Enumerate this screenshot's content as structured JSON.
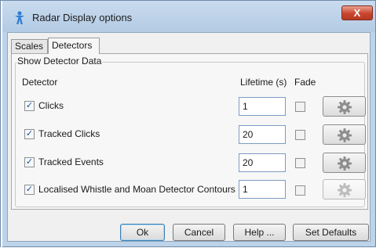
{
  "window": {
    "title": "Radar Display options",
    "close_label": "X"
  },
  "tabs": [
    {
      "label": "Scales",
      "selected": false
    },
    {
      "label": "Detectors",
      "selected": true
    }
  ],
  "group": {
    "title": "Show Detector Data",
    "col_detector": "Detector",
    "col_lifetime": "Lifetime (s)",
    "col_fade": "Fade"
  },
  "rows": [
    {
      "label": "Clicks",
      "checked": true,
      "lifetime": "1",
      "fade": false,
      "settings_enabled": true
    },
    {
      "label": "Tracked Clicks",
      "checked": true,
      "lifetime": "20",
      "fade": false,
      "settings_enabled": true
    },
    {
      "label": "Tracked Events",
      "checked": true,
      "lifetime": "20",
      "fade": false,
      "settings_enabled": true
    },
    {
      "label": "Localised Whistle and Moan Detector Contours",
      "checked": true,
      "lifetime": "1",
      "fade": false,
      "settings_enabled": false
    }
  ],
  "footer": {
    "ok": "Ok",
    "cancel": "Cancel",
    "help": "Help ...",
    "defaults": "Set Defaults"
  },
  "icons": {
    "app": "radar-person-icon",
    "settings": "gear-icon"
  },
  "colors": {
    "title_bar": "#bcd3ea",
    "close_button": "#c8452d"
  }
}
